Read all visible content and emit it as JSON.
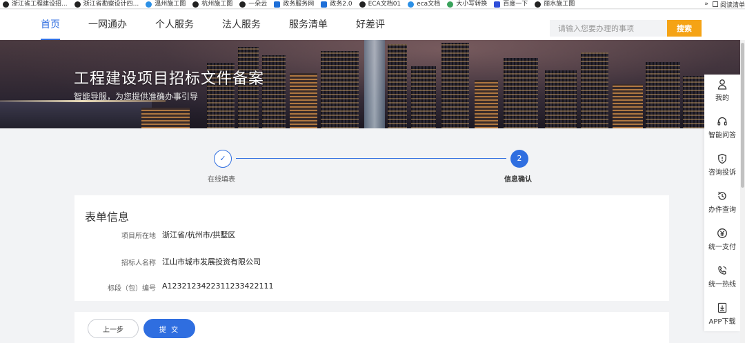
{
  "bookmarks": [
    {
      "label": "浙江省工程建设招...",
      "icon": "globe-icon"
    },
    {
      "label": "浙江省勘察设计四...",
      "icon": "globe-icon"
    },
    {
      "label": "温州施工图",
      "icon": "arrow-icon"
    },
    {
      "label": "杭州施工图",
      "icon": "globe-icon"
    },
    {
      "label": "一朵云",
      "icon": "globe-icon"
    },
    {
      "label": "政务服务网",
      "icon": "app-icon"
    },
    {
      "label": "政务2.0",
      "icon": "app-icon"
    },
    {
      "label": "ECA文档01",
      "icon": "globe-icon"
    },
    {
      "label": "eca文档",
      "icon": "app-icon"
    },
    {
      "label": "大小写转换",
      "icon": "leaf-icon"
    },
    {
      "label": "百度一下",
      "icon": "baidu-icon"
    },
    {
      "label": "丽水施工图",
      "icon": "globe-icon"
    }
  ],
  "bookmarks_overflow": "»",
  "reading_list": "阅读清单",
  "nav": {
    "items": [
      "首页",
      "一网通办",
      "个人服务",
      "法人服务",
      "服务清单",
      "好差评"
    ],
    "active_index": 0,
    "search_placeholder": "请输入您要办理的事项",
    "search_button": "搜索"
  },
  "banner": {
    "title": "工程建设项目招标文件备案",
    "subtitle": "智能导服，为您提供准确办事引导"
  },
  "steps": [
    {
      "label": "在线填表",
      "marker": "✓",
      "state": "done"
    },
    {
      "label": "信息确认",
      "marker": "2",
      "state": "active"
    }
  ],
  "form": {
    "title": "表单信息",
    "rows": [
      {
        "label": "项目所在地",
        "value": "浙江省/杭州市/拱墅区"
      },
      {
        "label": "招标人名称",
        "value": "江山市城市发展投资有限公司"
      },
      {
        "label": "标段（包）编号",
        "value": "A1232123422311233422111"
      }
    ]
  },
  "actions": {
    "prev": "上一步",
    "submit": "提 交"
  },
  "sidebar": [
    {
      "label": "我的",
      "icon": "user-icon"
    },
    {
      "label": "智能问答",
      "icon": "headset-icon"
    },
    {
      "label": "咨询投诉",
      "icon": "shield-alert-icon"
    },
    {
      "label": "办件查询",
      "icon": "history-icon"
    },
    {
      "label": "统一支付",
      "icon": "yen-icon"
    },
    {
      "label": "统一热线",
      "icon": "phone-icon"
    },
    {
      "label": "APP下载",
      "icon": "download-icon"
    }
  ],
  "colors": {
    "primary": "#2f6ee0",
    "search_button": "#f5a315",
    "page_bg": "#f2f3f5"
  }
}
